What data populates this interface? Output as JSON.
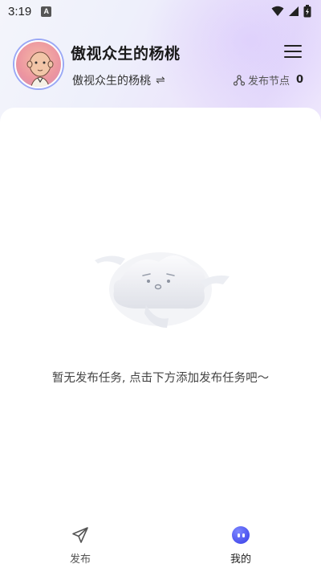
{
  "status_bar": {
    "time": "3:19",
    "notification_letter": "A",
    "icons": [
      "wifi-icon",
      "signal-icon",
      "battery-icon"
    ]
  },
  "header": {
    "username": "傲视众生的杨桃",
    "account_name": "傲视众生的杨桃",
    "switch_glyph": "⇌",
    "publish_nodes_label": "发布节点",
    "publish_nodes_count": "0",
    "menu_icon": "hamburger-menu-icon"
  },
  "empty_state": {
    "message": "暂无发布任务, 点击下方添加发布任务吧～",
    "illustration": "empty-cloud-illustration"
  },
  "tab_bar": {
    "tabs": [
      {
        "label": "发布",
        "icon": "send-icon",
        "active": false
      },
      {
        "label": "我的",
        "icon": "profile-face-icon",
        "active": true
      }
    ]
  },
  "colors": {
    "accent": "#4b52ee",
    "header_gradient_start": "#f4f5fb",
    "header_gradient_end": "#e6ddfb",
    "text_primary": "#1a1a1a",
    "text_secondary": "#555555"
  }
}
